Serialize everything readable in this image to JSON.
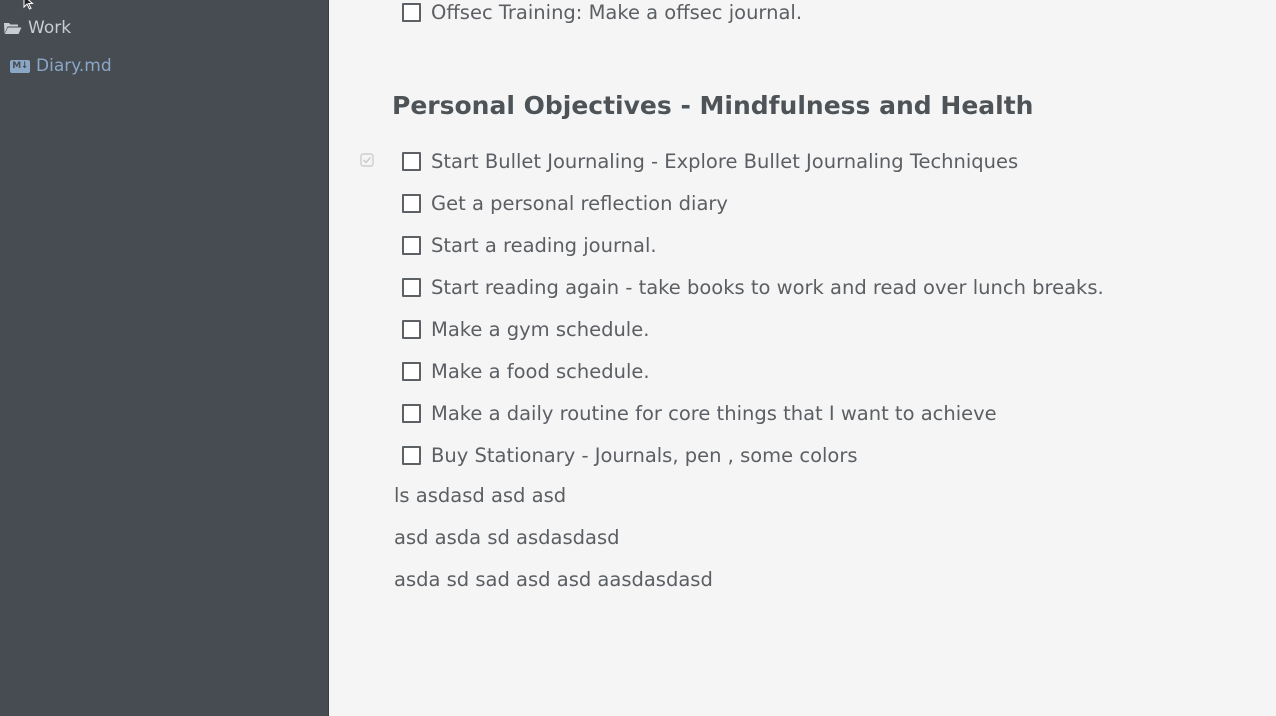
{
  "sidebar": {
    "folder": {
      "label": "Work",
      "icon": "folder-open-icon"
    },
    "file": {
      "label": "Diary.md",
      "icon": "markdown-icon",
      "badge": "M↓"
    }
  },
  "editor": {
    "top_task": {
      "label": "Offsec Training: Make a offsec journal.",
      "checked": false
    },
    "heading": "Personal Objectives - Mindfulness and Health",
    "tasks": [
      {
        "label": "Start Bullet Journaling - Explore Bullet Journaling Techniques",
        "checked": false
      },
      {
        "label": "Get a personal reflection diary",
        "checked": false
      },
      {
        "label": "Start a reading journal.",
        "checked": false
      },
      {
        "label": "Start reading again - take books to work and read over lunch breaks.",
        "checked": false
      },
      {
        "label": "Make a gym schedule.",
        "checked": false
      },
      {
        "label": "Make a food schedule.",
        "checked": false
      },
      {
        "label": "Make a daily routine for core things that I want to achieve",
        "checked": false
      },
      {
        "label": "Buy Stationary  - Journals, pen , some colors",
        "checked": false
      }
    ],
    "paragraphs": [
      "ls asdasd asd asd",
      "asd asda sd asdasdasd",
      "asda sd sad asd asd aasdasdasd"
    ]
  },
  "colors": {
    "sidebar_bg": "#474c53",
    "editor_bg": "#f5f5f5",
    "text": "#5b5f63",
    "link": "#8aa7c6"
  }
}
